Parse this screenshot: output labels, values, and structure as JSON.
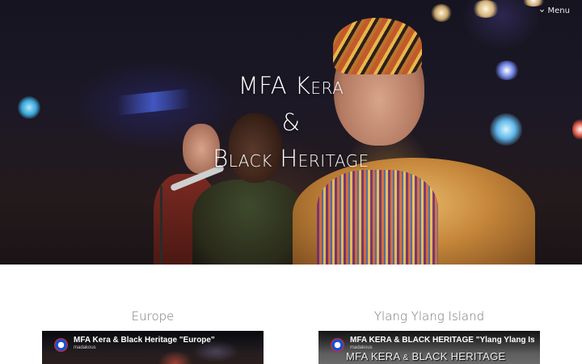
{
  "header": {
    "menu_label": "Menu"
  },
  "hero": {
    "title_line1": "MFA Kera",
    "title_line2": "&",
    "title_line3": "Black Heritage"
  },
  "videos": [
    {
      "heading": "Europe",
      "title": "MFA Kera & Black Heritage \"Europe\"",
      "channel": "madakous"
    },
    {
      "heading": "Ylang Ylang Island",
      "title": "MFA KERA & BLACK HERITAGE \"Ylang Ylang Isla",
      "channel": "madakous",
      "overlay_part1": "MFA KERA",
      "overlay_amp": "&",
      "overlay_part2": "BLACK HERITAGE"
    }
  ],
  "icons": {
    "menu": "chevron-down-icon",
    "channel": "channel-avatar"
  }
}
